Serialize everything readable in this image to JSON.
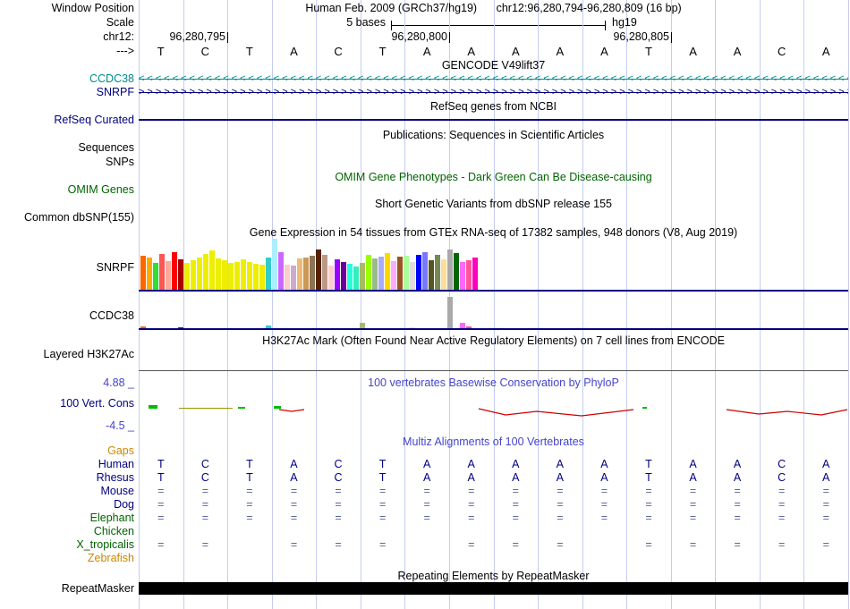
{
  "header": {
    "window_position_label": "Window Position",
    "assembly_title": "Human Feb. 2009 (GRCh37/hg19)",
    "range_title": "chr12:96,280,794-96,280,809 (16 bp)",
    "scale_label": "Scale",
    "scale_text": "5 bases",
    "assembly_short": "hg19",
    "chrom_label": "chr12:",
    "strand_label": "--->",
    "coords": [
      {
        "label": "96,280,795",
        "col": 2
      },
      {
        "label": "96,280,800",
        "col": 7
      },
      {
        "label": "96,280,805",
        "col": 12
      }
    ]
  },
  "sequence": [
    "T",
    "C",
    "T",
    "A",
    "C",
    "T",
    "A",
    "A",
    "A",
    "A",
    "A",
    "T",
    "A",
    "A",
    "C",
    "A"
  ],
  "gencode": {
    "title": "GENCODE V49lift37",
    "genes": [
      {
        "name": "CCDC38",
        "color": "#008B8B",
        "arrow": "<",
        "direction": "left"
      },
      {
        "name": "SNRPF",
        "color": "#000080",
        "arrow": ">",
        "direction": "right"
      }
    ]
  },
  "refseq": {
    "title": "RefSeq genes from NCBI",
    "label": "RefSeq Curated"
  },
  "publications": {
    "title": "Publications: Sequences in Scientific Articles",
    "rows": [
      "Sequences",
      "SNPs"
    ]
  },
  "omim": {
    "title": "OMIM Gene Phenotypes - Dark Green Can Be Disease-causing",
    "label": "OMIM Genes"
  },
  "dbsnp": {
    "title": "Short Genetic Variants from dbSNP release 155",
    "label": "Common dbSNP(155)"
  },
  "chart_data": {
    "type": "bar",
    "title": "Gene Expression in 54 tissues from GTEx RNA-seq of 17382 samples, 948 donors (V8, Aug 2019)",
    "tissue_colors": [
      "#FF6600",
      "#FFAA00",
      "#33DD33",
      "#FF5555",
      "#FFAA99",
      "#FF0000",
      "#AA0000",
      "#EEEE00",
      "#EEEE00",
      "#EEEE00",
      "#EEEE00",
      "#EEEE00",
      "#EEEE00",
      "#EEEE00",
      "#EEEE00",
      "#EEEE00",
      "#EEEE00",
      "#EEEE00",
      "#EEEE00",
      "#EEEE00",
      "#33CCCC",
      "#AAEEFF",
      "#CC66FF",
      "#FFCCCC",
      "#CCAACC",
      "#EEBB77",
      "#CC9955",
      "#8B7355",
      "#552200",
      "#BB9988",
      "#FFCCCC",
      "#9900FF",
      "#660099",
      "#22FFDD",
      "#33EEBB",
      "#AABB66",
      "#99FF00",
      "#99BB88",
      "#AAAAFF",
      "#FFD700",
      "#FFAAFF",
      "#995522",
      "#AAFF99",
      "#DDDDDD",
      "#0000FF",
      "#7777FF",
      "#555522",
      "#778855",
      "#FFDD99",
      "#AAAAAA",
      "#006600",
      "#FF66FF",
      "#FF5599",
      "#FF00BB"
    ],
    "tracks": [
      {
        "label": "SNRPF",
        "heights": [
          38,
          36,
          30,
          40,
          32,
          42,
          34,
          30,
          33,
          36,
          40,
          44,
          35,
          33,
          30,
          31,
          34,
          31,
          29,
          28,
          36,
          57,
          42,
          28,
          27,
          35,
          36,
          38,
          45,
          39,
          27,
          34,
          31,
          29,
          26,
          30,
          39,
          35,
          37,
          41,
          32,
          37,
          38,
          31,
          39,
          42,
          33,
          39,
          34,
          45,
          41,
          31,
          33,
          36
        ]
      },
      {
        "label": "CCDC38",
        "heights": [
          2,
          0,
          0,
          0,
          0,
          0,
          1,
          0,
          0,
          0,
          0,
          0,
          0,
          0,
          0,
          0,
          0,
          0,
          0,
          0,
          3,
          0,
          0,
          0,
          0,
          0,
          0,
          0,
          0,
          0,
          0,
          0,
          0,
          0,
          0,
          6,
          0,
          0,
          0,
          0,
          0,
          0,
          0,
          1,
          0,
          0,
          0,
          0,
          0,
          35,
          0,
          6,
          2,
          0
        ]
      }
    ]
  },
  "h3k27ac": {
    "title": "H3K27Ac Mark (Often Found Near Active Regulatory Elements) on 7 cell lines from ENCODE",
    "label": "Layered H3K27Ac"
  },
  "conservation": {
    "title": "100 vertebrates Basewise Conservation by PhyloP",
    "label": "100 Vert. Cons",
    "scale_max": "4.88 _",
    "scale_min": "-4.5 _",
    "green_ticks": [
      [
        166,
        10,
        4
      ],
      [
        266,
        8,
        2
      ],
      [
        306,
        8,
        3
      ],
      [
        718,
        5,
        2
      ]
    ],
    "olive_ticks": [
      [
        200,
        60,
        1
      ]
    ],
    "red_curves": [
      [
        [
          312,
          1
        ],
        [
          326,
          3
        ],
        [
          340,
          1
        ]
      ],
      [
        [
          535,
          0
        ],
        [
          565,
          7
        ],
        [
          600,
          3
        ],
        [
          650,
          8
        ],
        [
          708,
          1
        ]
      ],
      [
        [
          812,
          1
        ],
        [
          848,
          6
        ],
        [
          880,
          3
        ],
        [
          918,
          7
        ],
        [
          947,
          1
        ]
      ]
    ]
  },
  "multiz": {
    "title": "Multiz Alignments of 100 Vertebrates",
    "species": [
      {
        "name": "Gaps",
        "color": "#CC8800",
        "cells": [
          "",
          "",
          "",
          "",
          "",
          "",
          "",
          "",
          "",
          "",
          "",
          "",
          "",
          "",
          "",
          ""
        ]
      },
      {
        "name": "Human",
        "color": "#000080",
        "cells": [
          "T",
          "C",
          "T",
          "A",
          "C",
          "T",
          "A",
          "A",
          "A",
          "A",
          "A",
          "T",
          "A",
          "A",
          "C",
          "A"
        ]
      },
      {
        "name": "Rhesus",
        "color": "#000080",
        "cells": [
          "T",
          "C",
          "T",
          "A",
          "C",
          "T",
          "A",
          "A",
          "A",
          "A",
          "A",
          "T",
          "A",
          "A",
          "C",
          "A"
        ]
      },
      {
        "name": "Mouse",
        "color": "#000080",
        "cells": [
          "=",
          "=",
          "=",
          "=",
          "=",
          "=",
          "=",
          "=",
          "=",
          "=",
          "=",
          "=",
          "=",
          "=",
          "=",
          "="
        ]
      },
      {
        "name": "Dog",
        "color": "#000080",
        "cells": [
          "=",
          "=",
          "=",
          "=",
          "=",
          "=",
          "=",
          "=",
          "=",
          "=",
          "=",
          "=",
          "=",
          "=",
          "=",
          "="
        ]
      },
      {
        "name": "Elephant",
        "color": "#006400",
        "cells": [
          "=",
          "=",
          "=",
          "=",
          "=",
          "=",
          "=",
          "=",
          "=",
          "=",
          "=",
          "=",
          "=",
          "=",
          "=",
          "="
        ]
      },
      {
        "name": "Chicken",
        "color": "#006400",
        "cells": [
          "",
          "",
          "",
          "",
          "",
          "",
          "",
          "",
          "",
          "",
          "",
          "",
          "",
          "",
          "",
          ""
        ]
      },
      {
        "name": "X_tropicalis",
        "color": "#006400",
        "cells": [
          "=",
          "=",
          "",
          "=",
          "=",
          "=",
          "",
          "=",
          "=",
          "=",
          "",
          "=",
          "=",
          "=",
          "=",
          "="
        ]
      },
      {
        "name": "Zebrafish",
        "color": "#CC8800",
        "cells": [
          "",
          "",
          "",
          "",
          "",
          "",
          "",
          "",
          "",
          "",
          "",
          "",
          "",
          "",
          "",
          ""
        ]
      }
    ]
  },
  "repeatmasker": {
    "title": "Repeating Elements by RepeatMasker",
    "label": "RepeatMasker"
  },
  "colors": {
    "navy": "#000080",
    "teal": "#008B8B",
    "omim_green": "#006400",
    "title_blue": "#4444CC",
    "gridline": "#C4CDF0",
    "conservation_green": "#00BB00",
    "conservation_red": "#CC0000",
    "equals_gray_blue": "#5A6A96"
  }
}
